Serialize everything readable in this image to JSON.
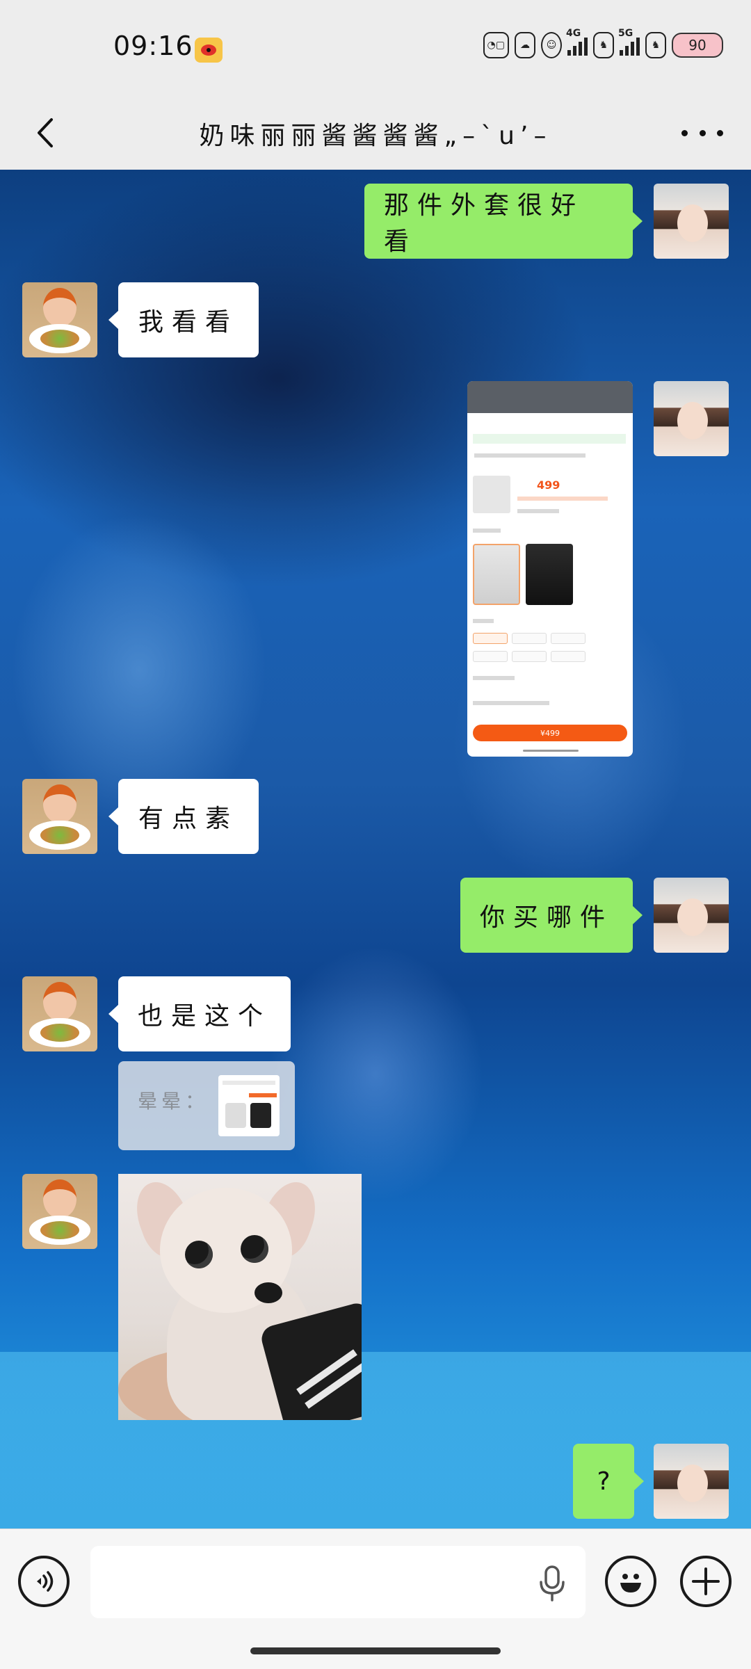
{
  "status_bar": {
    "time": "09:16",
    "icons": [
      "weibo-icon",
      "app-icon-1",
      "app-icon-2",
      "app-icon-3"
    ],
    "network_1": "4G",
    "network_2": "5G",
    "battery": "90"
  },
  "header": {
    "title": "奶味丽丽酱酱酱酱„–ˋu’–",
    "back_icon": "chevron-left-icon",
    "more_icon": "more-dots-icon"
  },
  "messages": [
    {
      "sender": "me",
      "type": "text",
      "text": "那件外套很好看"
    },
    {
      "sender": "friend",
      "type": "text",
      "text": "我看看"
    },
    {
      "sender": "me",
      "type": "image",
      "image_price": "499",
      "image_button": "¥499"
    },
    {
      "sender": "friend",
      "type": "text",
      "text": "有点素"
    },
    {
      "sender": "me",
      "type": "text",
      "text": "你买哪件"
    },
    {
      "sender": "friend",
      "type": "text",
      "text": "也是这个"
    },
    {
      "sender": "friend",
      "type": "quote",
      "quote_author": "晕晕："
    },
    {
      "sender": "friend",
      "type": "sticker",
      "sticker": "chihuahua-sticker"
    },
    {
      "sender": "me",
      "type": "text",
      "text": "?"
    }
  ],
  "input": {
    "placeholder": "",
    "value": "",
    "voice_icon": "voice-icon",
    "mic_icon": "microphone-icon",
    "emoji_icon": "emoji-icon",
    "plus_icon": "plus-icon"
  },
  "colors": {
    "my_bubble": "#95ec69",
    "friend_bubble": "#ffffff",
    "bar_background": "#ededed"
  }
}
